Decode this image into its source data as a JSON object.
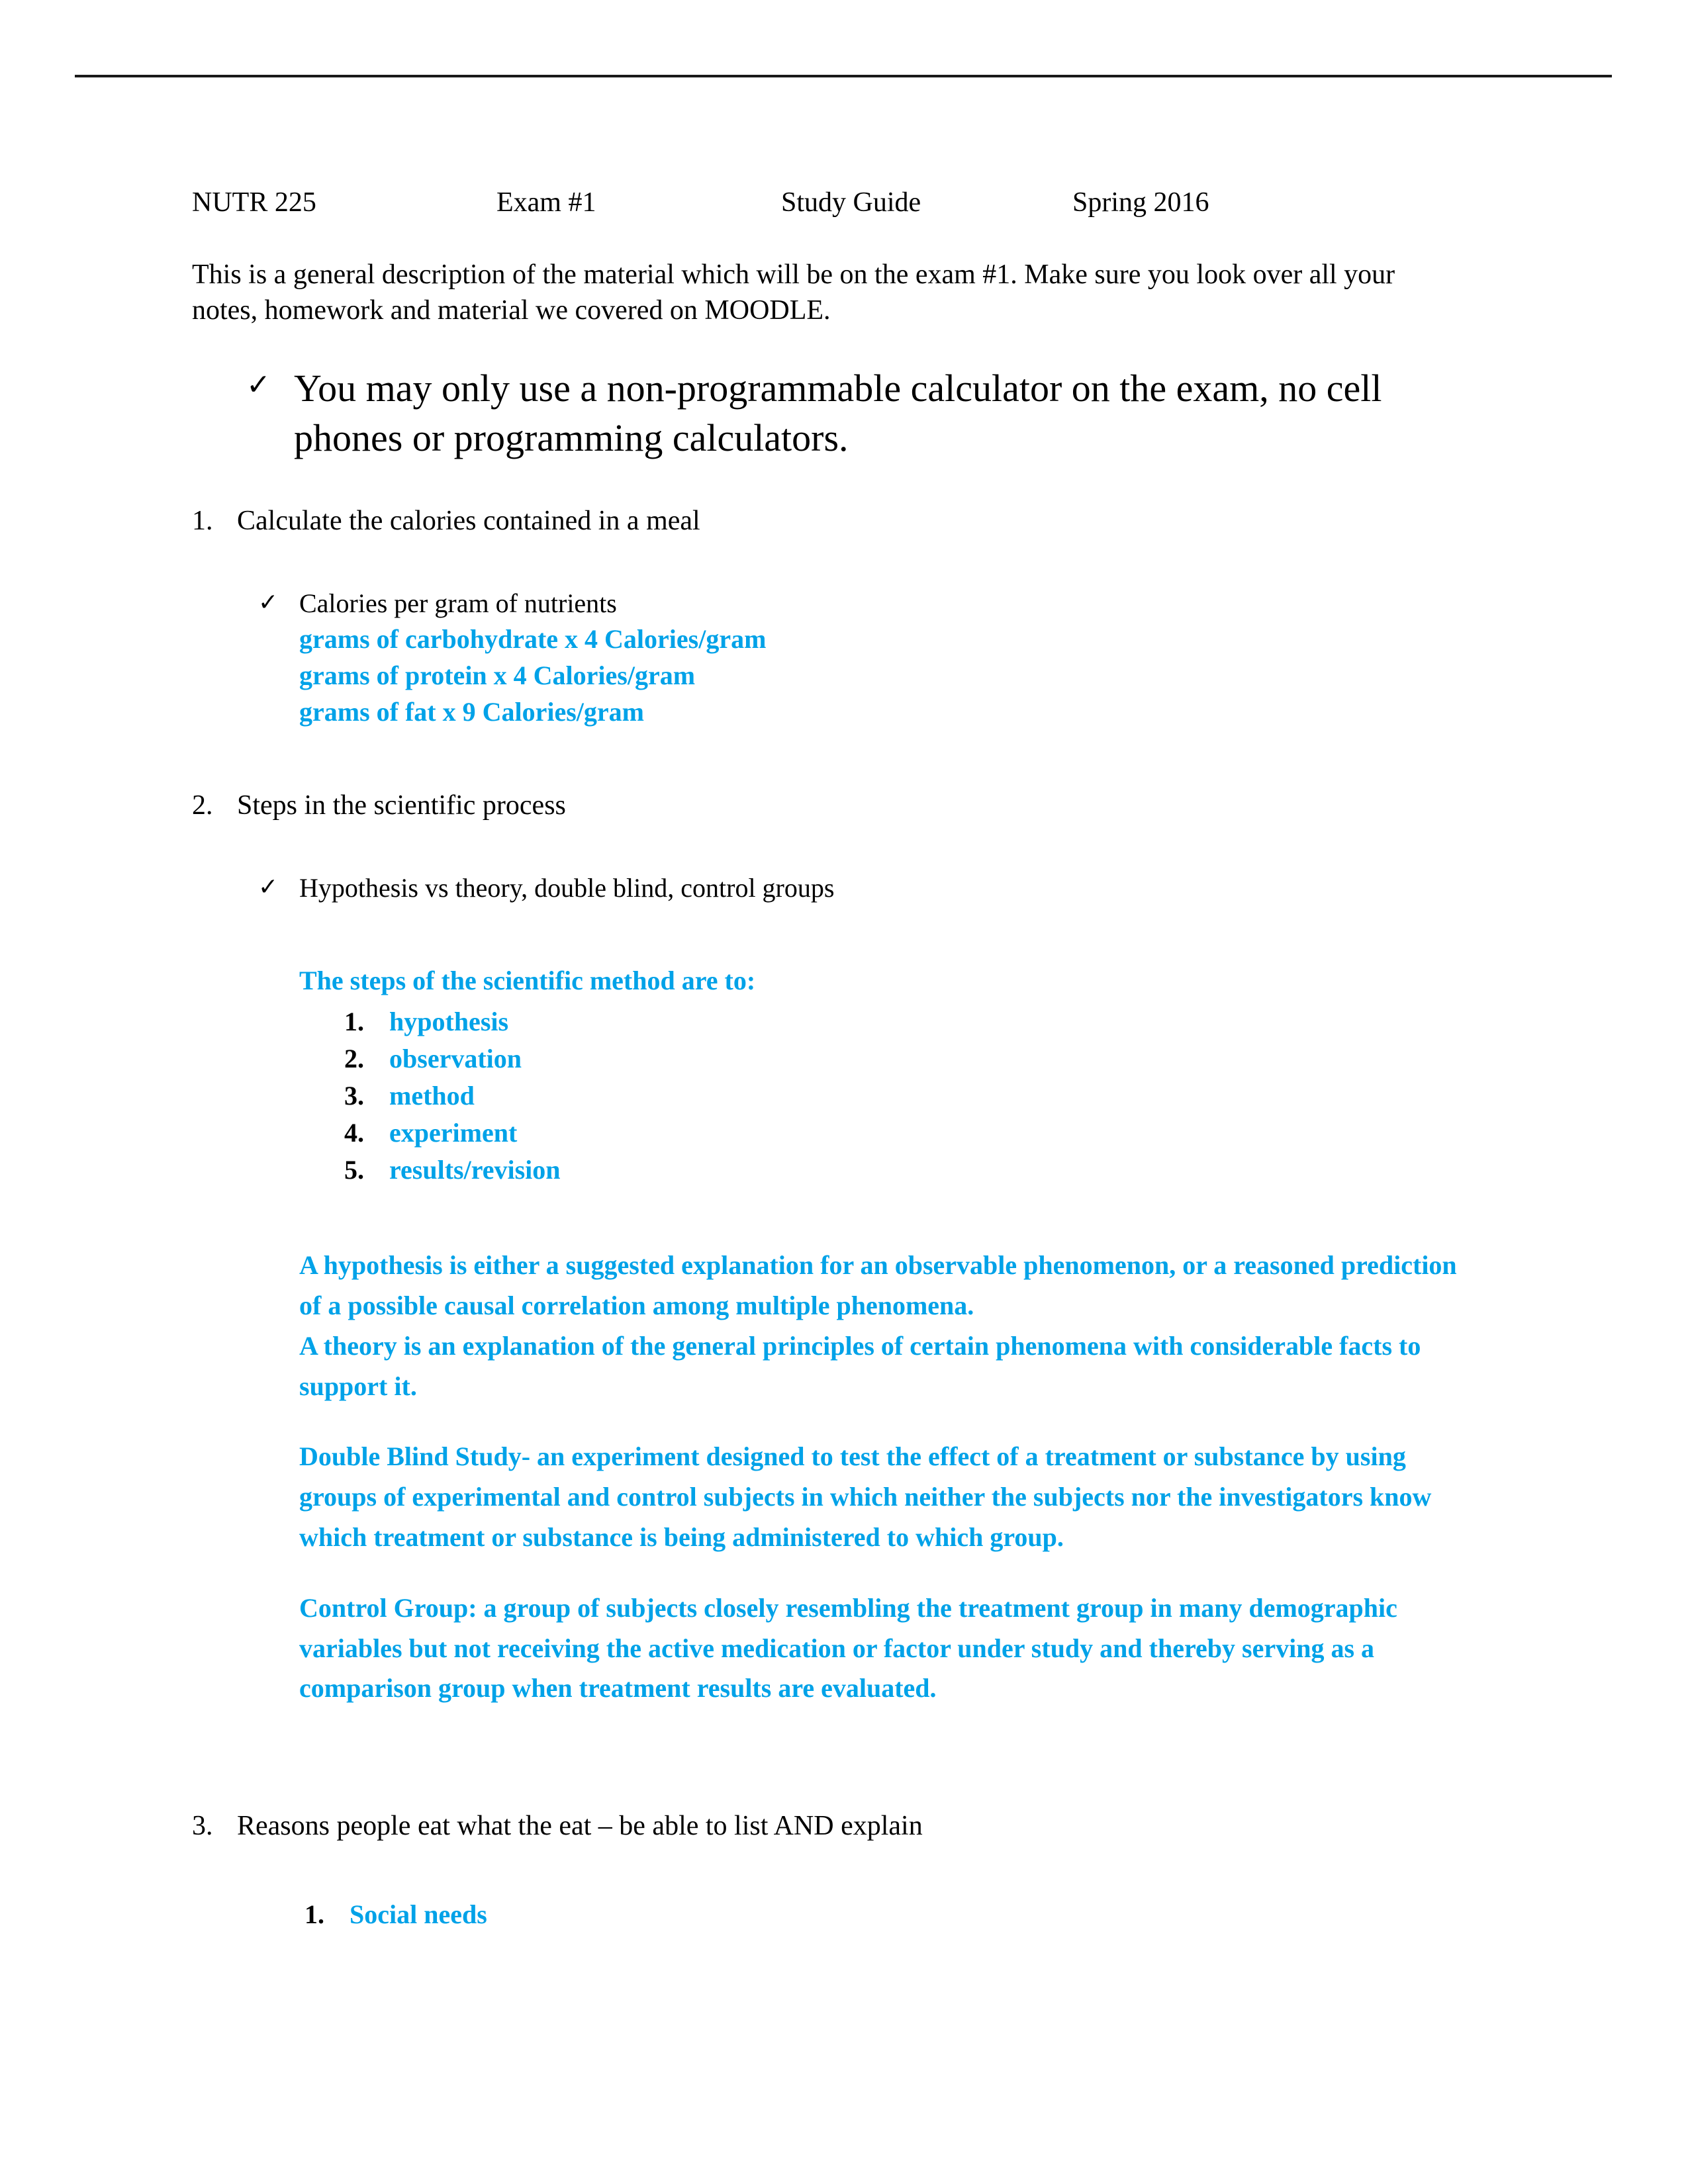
{
  "document": {
    "header_rule": true,
    "accent_color": "#00a2e8",
    "title_line": {
      "course": "NUTR 225",
      "exam": "Exam #1",
      "kind": "Study Guide",
      "term": "Spring 2016"
    },
    "intro": "This is a general description of the material which will be on the exam #1.  Make sure you look over all your notes, homework and material we covered on MOODLE.",
    "callout": {
      "bullet": "check-icon",
      "text": "You may only use a non-programmable calculator on the exam, no cell phones or programming calculators."
    },
    "items": [
      {
        "number": "1.",
        "heading": "Calculate the calories contained in a meal",
        "subbullet": {
          "bullet": "check-icon",
          "text": "Calories per gram of nutrients"
        },
        "blue_lines": [
          "grams of carbohydrate   x   4 Calories/gram",
          "grams of protein    x    4 Calories/gram",
          "grams of fat    x    9 Calories/gram"
        ]
      },
      {
        "number": "2.",
        "heading": "Steps in the scientific process",
        "subbullet": {
          "bullet": "check-icon",
          "text": "Hypothesis vs theory, double blind, control groups"
        },
        "blue_head": "The steps of the scientific method are to:",
        "blue_list": [
          {
            "num": "1.",
            "label": "hypothesis"
          },
          {
            "num": "2.",
            "label": "observation"
          },
          {
            "num": "3.",
            "label": "method"
          },
          {
            "num": "4.",
            "label": "experiment"
          },
          {
            "num": "5.",
            "label": "results/revision"
          }
        ],
        "blue_paragraphs": [
          "A hypothesis is either a suggested explanation for an observable phenomenon, or a reasoned prediction of a possible causal correlation among multiple phenomena.\nA theory is an explanation of the general principles of certain phenomena with considerable facts to support it.",
          "Double Blind Study- an experiment designed to test the effect of a treatment or substance by using groups of experimental and control subjects in which neither the subjects nor the investigators know which treatment or substance is being administered to which group.",
          "Control Group: a group of subjects closely resembling the treatment group in many demographic variables but not receiving the active medication or factor under study and thereby serving as a comparison group when treatment results are evaluated."
        ]
      },
      {
        "number": "3.",
        "heading": "Reasons people eat what the eat – be able to list AND explain",
        "blue_list": [
          {
            "num": "1.",
            "label": "Social needs"
          }
        ]
      }
    ],
    "glyphs": {
      "check": "✓"
    }
  }
}
